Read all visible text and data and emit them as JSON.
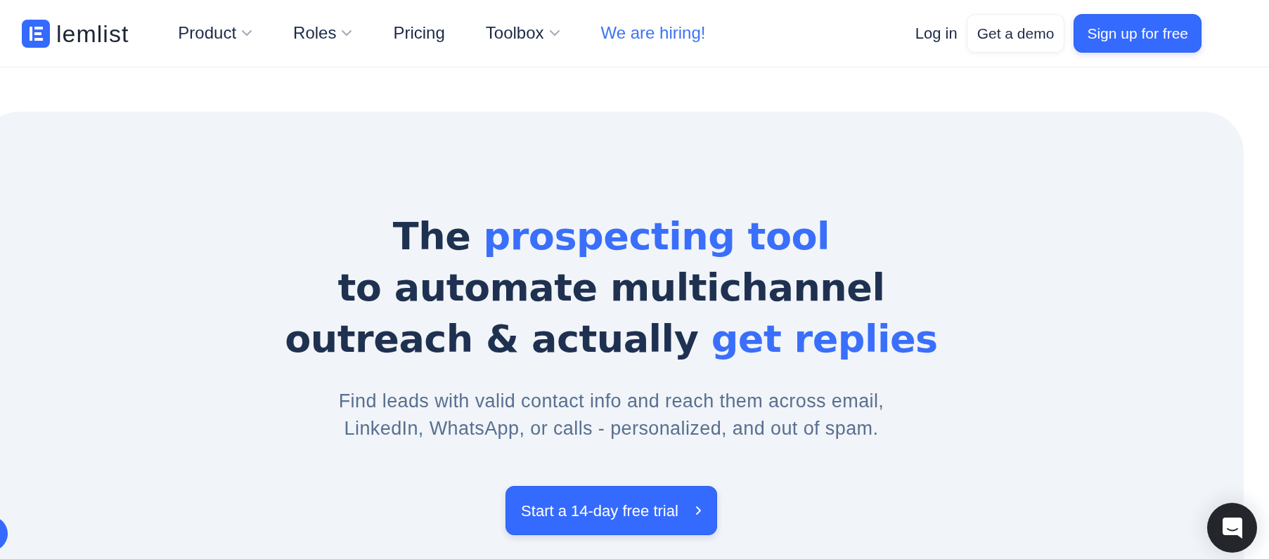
{
  "brand": {
    "name": "lemlist"
  },
  "nav": {
    "items": [
      {
        "label": "Product",
        "kind": "dropdown"
      },
      {
        "label": "Roles",
        "kind": "dropdown"
      },
      {
        "label": "Pricing",
        "kind": "link"
      },
      {
        "label": "Toolbox",
        "kind": "dropdown"
      },
      {
        "label": "We are hiring!",
        "kind": "accent"
      }
    ]
  },
  "actions": [
    {
      "label": "Log in",
      "kind": "link"
    },
    {
      "label": "Get a demo",
      "kind": "secondary"
    },
    {
      "label": "Sign up for free",
      "kind": "primary"
    }
  ],
  "hero": {
    "headline": [
      [
        {
          "text": "The",
          "accent": false
        },
        {
          "text": "prospecting tool",
          "accent": true
        }
      ],
      [
        {
          "text": "to automate multichannel",
          "accent": false
        }
      ],
      [
        {
          "text": "outreach & actually",
          "accent": false
        },
        {
          "text": "get replies",
          "accent": true
        }
      ]
    ],
    "subtitle": "Find leads with valid contact info and reach them across email, LinkedIn, WhatsApp, or calls - personalized, and out of spam.",
    "cta": {
      "label": "Start a 14-day free trial"
    }
  }
}
